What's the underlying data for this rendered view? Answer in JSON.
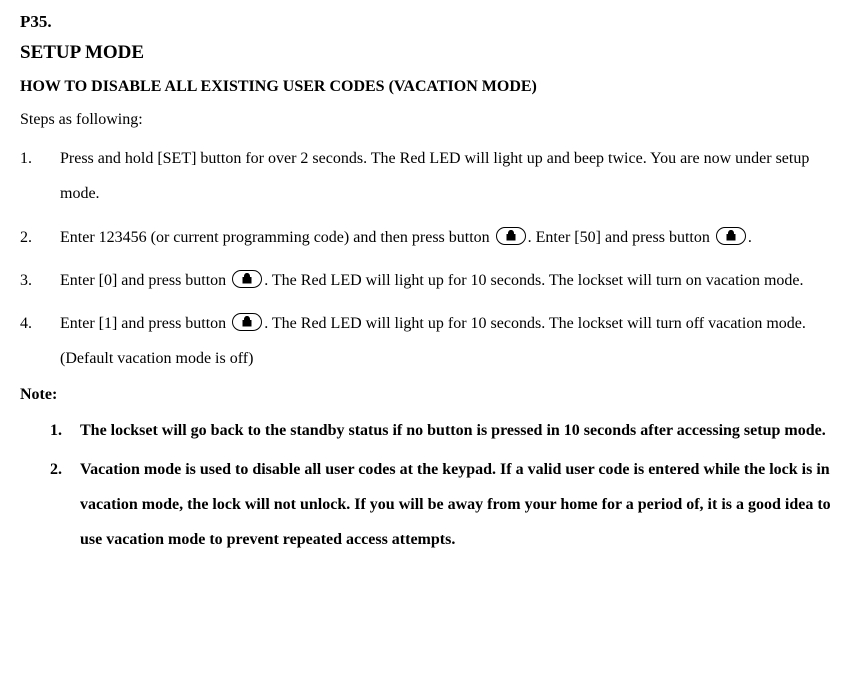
{
  "page_number": "P35.",
  "heading1": "SETUP MODE",
  "heading2": "HOW TO DISABLE ALL EXISTING USER CODES (VACATION MODE)",
  "intro": "Steps as following:",
  "steps": [
    {
      "pre": "Press and hold [SET] button for over 2 seconds. The Red LED will light up and beep twice. You are now under setup mode."
    },
    {
      "pre": "Enter 123456 (or current programming code) and then press button ",
      "mid": ". Enter [50] and press button ",
      "post": "."
    },
    {
      "pre": "Enter [0] and press button ",
      "post": ". The Red LED will light up for 10 seconds. The lockset will turn on vacation mode."
    },
    {
      "pre": "Enter [1] and press button ",
      "post": ". The Red LED will light up for 10 seconds. The lockset will turn off vacation mode. (Default vacation mode is off)"
    }
  ],
  "note_label": "Note:",
  "notes": [
    "The lockset will go back to the standby status if no button is pressed in 10 seconds after accessing setup mode.",
    "Vacation mode is used to disable all user codes at the keypad. If a valid user code is entered while the lock is in vacation mode, the lock will not unlock. If you will be away from your home for a period of, it is a good idea to use vacation mode to prevent repeated access attempts."
  ]
}
